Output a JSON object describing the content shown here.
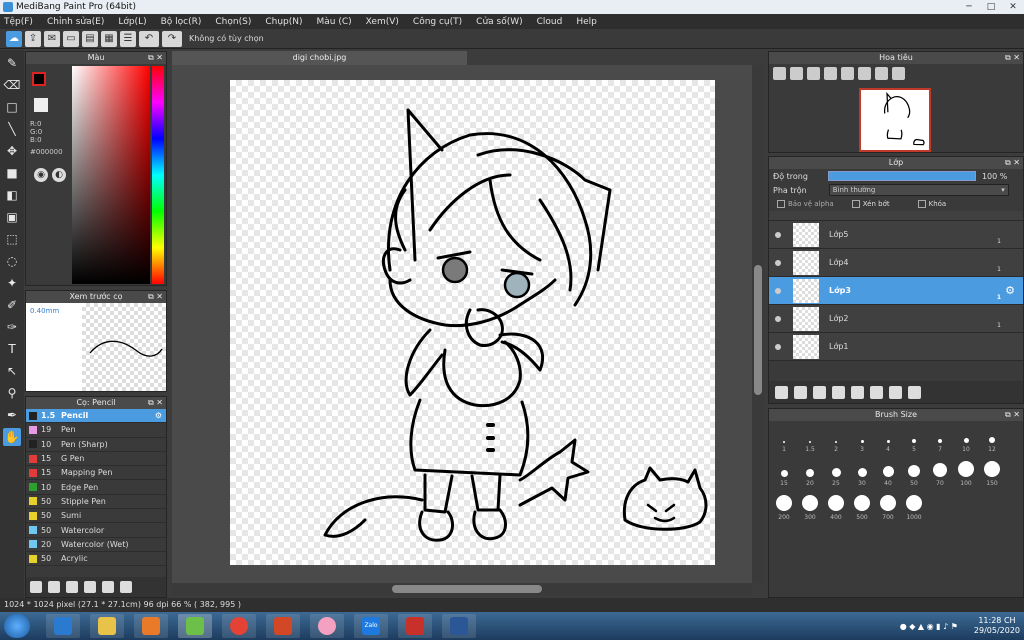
{
  "window": {
    "title": "MediBang Paint Pro (64bit)",
    "buttons": [
      "─",
      "□",
      "✕"
    ]
  },
  "menu": [
    "Tệp(F)",
    "Chỉnh sửa(E)",
    "Lớp(L)",
    "Bộ lọc(R)",
    "Chọn(S)",
    "Chụp(N)",
    "Màu (C)",
    "Xem(V)",
    "Công cụ(T)",
    "Cửa số(W)",
    "Cloud",
    "Help"
  ],
  "toolbar": {
    "selection_status": "Không có tùy chọn"
  },
  "color_panel": {
    "title": "Màu",
    "r": "R:0",
    "g": "G:0",
    "b": "B:0",
    "hex": "#000000",
    "fg": "#000000",
    "bg": "#eeeeee"
  },
  "brush_preview": {
    "title": "Xem trước cọ",
    "size": "0.40mm"
  },
  "brush_panel": {
    "title": "Cọ: Pencil",
    "items": [
      {
        "size": "1.5",
        "name": "Pencil",
        "color": "#222222"
      },
      {
        "size": "19",
        "name": "Pen",
        "color": "#e99ae6"
      },
      {
        "size": "10",
        "name": "Pen (Sharp)",
        "color": "#222222"
      },
      {
        "size": "15",
        "name": "G Pen",
        "color": "#e23b3b"
      },
      {
        "size": "15",
        "name": "Mapping Pen",
        "color": "#e23b3b"
      },
      {
        "size": "10",
        "name": "Edge Pen",
        "color": "#2ea02e"
      },
      {
        "size": "50",
        "name": "Stipple Pen",
        "color": "#e8d02a"
      },
      {
        "size": "50",
        "name": "Sumi",
        "color": "#e8d02a"
      },
      {
        "size": "50",
        "name": "Watercolor",
        "color": "#6fc8ef"
      },
      {
        "size": "20",
        "name": "Watercolor (Wet)",
        "color": "#6fc8ef"
      },
      {
        "size": "50",
        "name": "Acrylic",
        "color": "#e8d02a"
      }
    ]
  },
  "document": {
    "tab": "digi chobi.jpg"
  },
  "navigator": {
    "title": "Hoa tiêu"
  },
  "layer_panel": {
    "title": "Lớp",
    "opacity_label": "Độ trong",
    "opacity": "100 %",
    "opacity_value": 100,
    "blend_label": "Pha trộn",
    "blend_value": "Bình thường",
    "protect_alpha": "Bảo vệ alpha",
    "clip": "Xén bớt",
    "lock": "Khóa",
    "layers": [
      {
        "name": "Lớp5",
        "num": "1",
        "selected": false
      },
      {
        "name": "Lớp4",
        "num": "1",
        "selected": false
      },
      {
        "name": "Lớp3",
        "num": "1",
        "selected": true
      },
      {
        "name": "Lớp2",
        "num": "1",
        "selected": false
      },
      {
        "name": "Lớp1",
        "num": "",
        "selected": false
      }
    ]
  },
  "brush_size": {
    "title": "Brush Size",
    "sizes": [
      "1",
      "1.5",
      "2",
      "3",
      "4",
      "5",
      "7",
      "10",
      "12",
      "15",
      "20",
      "25",
      "30",
      "40",
      "50",
      "70",
      "100",
      "150",
      "200",
      "300",
      "400",
      "500",
      "700",
      "1000"
    ]
  },
  "statusbar": {
    "text": "1024 * 1024 pixel  (27.1 * 27.1cm)  96 dpi  66 %  ( 382, 995 )"
  },
  "taskbar": {
    "time": "11:28 CH",
    "date": "29/05/2020",
    "zalo": "Zalo"
  }
}
